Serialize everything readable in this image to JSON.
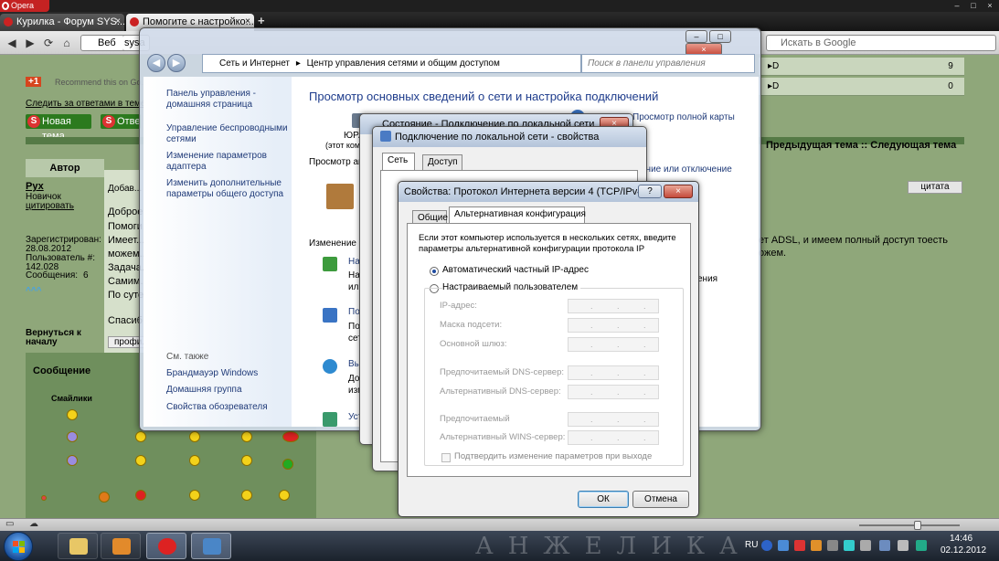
{
  "browser": {
    "menu_label": "Opera",
    "tabs": [
      {
        "label": "Курилка - Форум SYS...",
        "close": "×"
      },
      {
        "label": "Помогите с настройко...",
        "close": "×"
      }
    ],
    "new_tab": "+",
    "address_label": "Веб",
    "address_value": "sysa",
    "search_placeholder": "Искать в Google",
    "window_controls": [
      "–",
      "□",
      "×"
    ]
  },
  "forum": {
    "recommend_count": "+1",
    "recommend_text": "Recommend this on Go...",
    "follow_link": "Следить за ответами в теме",
    "new_topic_button": "Новая тема",
    "reply_button": "Отве...",
    "author_header": "Автор",
    "author_name": "Рух",
    "author_rank": "Новичок",
    "author_quote": "цитировать",
    "registered_label": "Зарегистрирован:",
    "registered_date": "28.08.2012",
    "user_no_label": "Пользователь #:",
    "user_no": "142.028",
    "messages_label": "Сообщения:",
    "messages_count": "6",
    "back_to_top": "Вернуться к началу",
    "profile_btn": "профи...",
    "message_heading": "Сообщение",
    "smileys_heading": "Смайлики",
    "added_prefix": "Добав...",
    "post_lines": [
      "Доброе...",
      "Помоги...",
      "Имеет...",
      "можем...",
      "Задача...",
      "Самим...",
      "По суте...",
      "Спасиб..."
    ],
    "nav_prev_next": "Предыдущая тема :: Следующая тема",
    "quote_button": "цитата",
    "right_text_line1": "ет ADSL, и имеем полный доступ тоесть",
    "right_text_line2": "ожем.",
    "list_counts": [
      "9",
      "0"
    ]
  },
  "control_panel": {
    "title_controls": [
      "–",
      "□",
      "×"
    ],
    "breadcrumb": [
      "Сеть и Интернет",
      "Центр управления сетями и общим доступом"
    ],
    "search_placeholder": "Поиск в панели управления",
    "sidebar": {
      "home": "Панель управления - домашняя страница",
      "items": [
        "Управление беспроводными сетями",
        "Изменение параметров адаптера",
        "Изменить дополнительные параметры общего доступа"
      ],
      "see_also_label": "См. также",
      "see_also": [
        "Брандмауэр Windows",
        "Домашняя группа",
        "Свойства обозревателя"
      ]
    },
    "main_title": "Просмотр основных сведений о сети и настройка подключений",
    "view_full_map": "Просмотр полной карты",
    "computer_name": "ЮРА",
    "computer_note": "(этот компь...",
    "active_networks": "Просмотр ак...",
    "connect_disconnect": "ение или отключение",
    "change_settings": "Изменение се...",
    "tasks": [
      {
        "title": "Нас...",
        "desc": [
          "Нас...",
          "или..."
        ]
      },
      {
        "title": "Под...",
        "desc": [
          "Под...",
          "сети..."
        ]
      },
      {
        "title": "Выб...",
        "desc": [
          "Дос...",
          "изм..."
        ]
      },
      {
        "title": "Уст...",
        "desc": []
      }
    ],
    "side_word": "ения"
  },
  "status_dialog": {
    "title": "Состояние - Подключение по локальной сети"
  },
  "props_dialog": {
    "title": "Подключение по локальной сети - свойства",
    "tabs": [
      "Сеть",
      "Доступ"
    ]
  },
  "ipv4_dialog": {
    "title": "Свойства: Протокол Интернета версии 4 (TCP/IPv4)",
    "help": "?",
    "close": "×",
    "tabs": [
      "Общие",
      "Альтернативная конфигурация"
    ],
    "description": "Если этот компьютер используется в нескольких сетях, введите параметры альтернативной конфигурации протокола IP",
    "option_auto": "Автоматический частный IP-адрес",
    "option_manual": "Настраиваемый пользователем",
    "fields": [
      {
        "label": "IP-адрес:",
        "value": ". . ."
      },
      {
        "label": "Маска подсети:",
        "value": ". . ."
      },
      {
        "label": "Основной шлюз:",
        "value": ". . ."
      },
      {
        "label": "Предпочитаемый DNS-сервер:",
        "value": ". . ."
      },
      {
        "label": "Альтернативный DNS-сервер:",
        "value": ". . ."
      },
      {
        "label": "Предпочитаемый",
        "value": ". . ."
      },
      {
        "label": "Альтернативный WINS-сервер:",
        "value": ". . ."
      }
    ],
    "validate_label": "Подтвердить изменение параметров при выходе",
    "ok": "ОК",
    "cancel": "Отмена"
  },
  "taskbar": {
    "lang": "RU",
    "time": "14:46",
    "date": "02.12.2012",
    "wallpaper_text": "АНЖЕЛИКА"
  }
}
